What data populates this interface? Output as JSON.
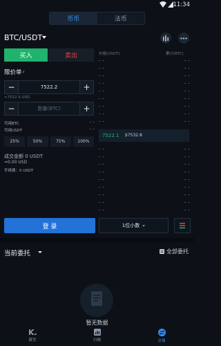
{
  "status_bar": {
    "time": "11:34"
  },
  "market_tabs": [
    {
      "label": "币币",
      "active": true
    },
    {
      "label": "法币",
      "active": false
    }
  ],
  "pair": {
    "symbol": "BTC/USDT"
  },
  "trade_side": {
    "buy": "买入",
    "sell": "卖出"
  },
  "order_type": "限价单",
  "price_input": {
    "value": "7522.2",
    "converted": "≈7532.9 USD"
  },
  "amount_input": {
    "placeholder": "数量(BTC)"
  },
  "available": {
    "btc_label": "可用BTC",
    "usdt_label": "可用USDT",
    "btc_value": "- -",
    "usdt_value": "- -"
  },
  "percent_buttons": [
    "25%",
    "50%",
    "75%",
    "100%"
  ],
  "totals": {
    "amount": "成交金额 0 USDT",
    "usd": "≈0.00 USD",
    "fee": "手续费：0 USDT"
  },
  "order_book": {
    "header_price": "价格(USDT)",
    "header_cumulative": "累计(BTC)",
    "empty_cell": "- -",
    "last_price": "7522.1",
    "last_price_usd": "$7532.8"
  },
  "login_button": "登 录",
  "decimal_select": "1位小数",
  "current_orders": {
    "title": "当前委托",
    "all_orders": "全部委托"
  },
  "empty_state": "暂无数据",
  "bottom_nav": [
    {
      "label": "首页",
      "active": false
    },
    {
      "label": "行情",
      "active": false
    },
    {
      "label": "交易",
      "active": true
    }
  ],
  "colors": {
    "buy": "#1fb36d",
    "sell": "#e0424c",
    "accent": "#2272d8",
    "background": "#0d1117"
  }
}
